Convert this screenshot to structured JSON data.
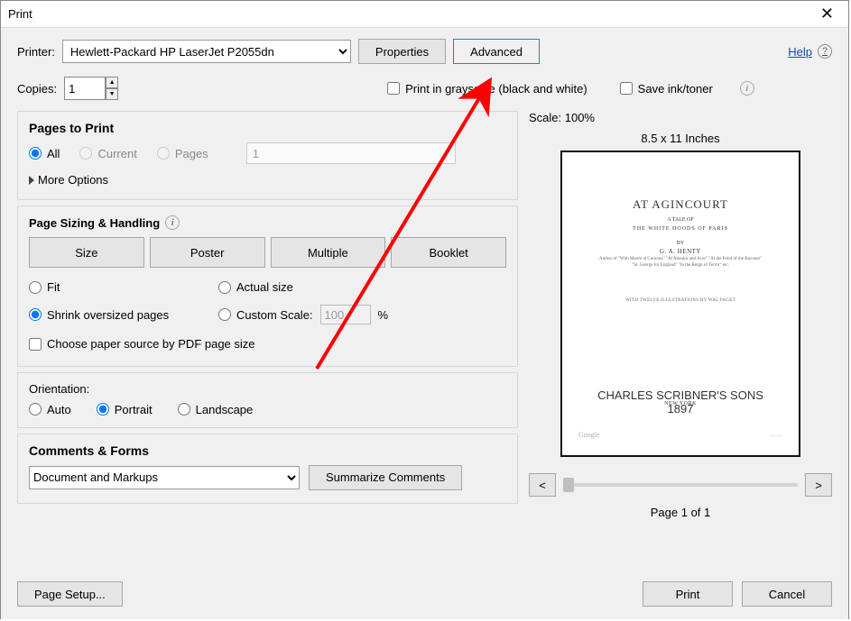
{
  "window": {
    "title": "Print"
  },
  "top": {
    "printer_label": "Printer:",
    "printer_value": "Hewlett-Packard HP LaserJet P2055dn",
    "properties": "Properties",
    "advanced": "Advanced",
    "help": "Help"
  },
  "copies": {
    "label": "Copies:",
    "value": "1",
    "grayscale": "Print in grayscale (black and white)",
    "save_ink": "Save ink/toner"
  },
  "pages": {
    "title": "Pages to Print",
    "all": "All",
    "current": "Current",
    "pages": "Pages",
    "range": "1",
    "more": "More Options"
  },
  "sizing": {
    "title": "Page Sizing & Handling",
    "size": "Size",
    "poster": "Poster",
    "multiple": "Multiple",
    "booklet": "Booklet",
    "fit": "Fit",
    "actual": "Actual size",
    "shrink": "Shrink oversized pages",
    "custom": "Custom Scale:",
    "custom_val": "100",
    "pct": "%",
    "choose_source": "Choose paper source by PDF page size"
  },
  "orient": {
    "label": "Orientation:",
    "auto": "Auto",
    "portrait": "Portrait",
    "landscape": "Landscape"
  },
  "comments": {
    "title": "Comments & Forms",
    "combo": "Document and Markups",
    "summarize": "Summarize Comments"
  },
  "preview": {
    "scale": "Scale: 100%",
    "dims": "8.5 x 11 Inches",
    "title": "AT AGINCOURT",
    "sub1": "A TALE OF",
    "sub2": "THE WHITE HOODS OF PARIS",
    "by": "BY",
    "author": "G. A. HENTY",
    "line1": "Author of \"With Moore at Corunna\" \"At Aboukir and Acre\" \"At the Point of the Bayonet\"",
    "line2": "\"St. George for England\" \"In the Reign of Terror\" etc.",
    "illus": "WITH TWELVE ILLUSTRATIONS BY WAL PAGET",
    "city": "NEW YORK",
    "publisher": "CHARLES SCRIBNER'S SONS",
    "year": "1897",
    "google": "Google",
    "pageof": "Page 1 of 1"
  },
  "footer": {
    "setup": "Page Setup...",
    "print": "Print",
    "cancel": "Cancel"
  }
}
